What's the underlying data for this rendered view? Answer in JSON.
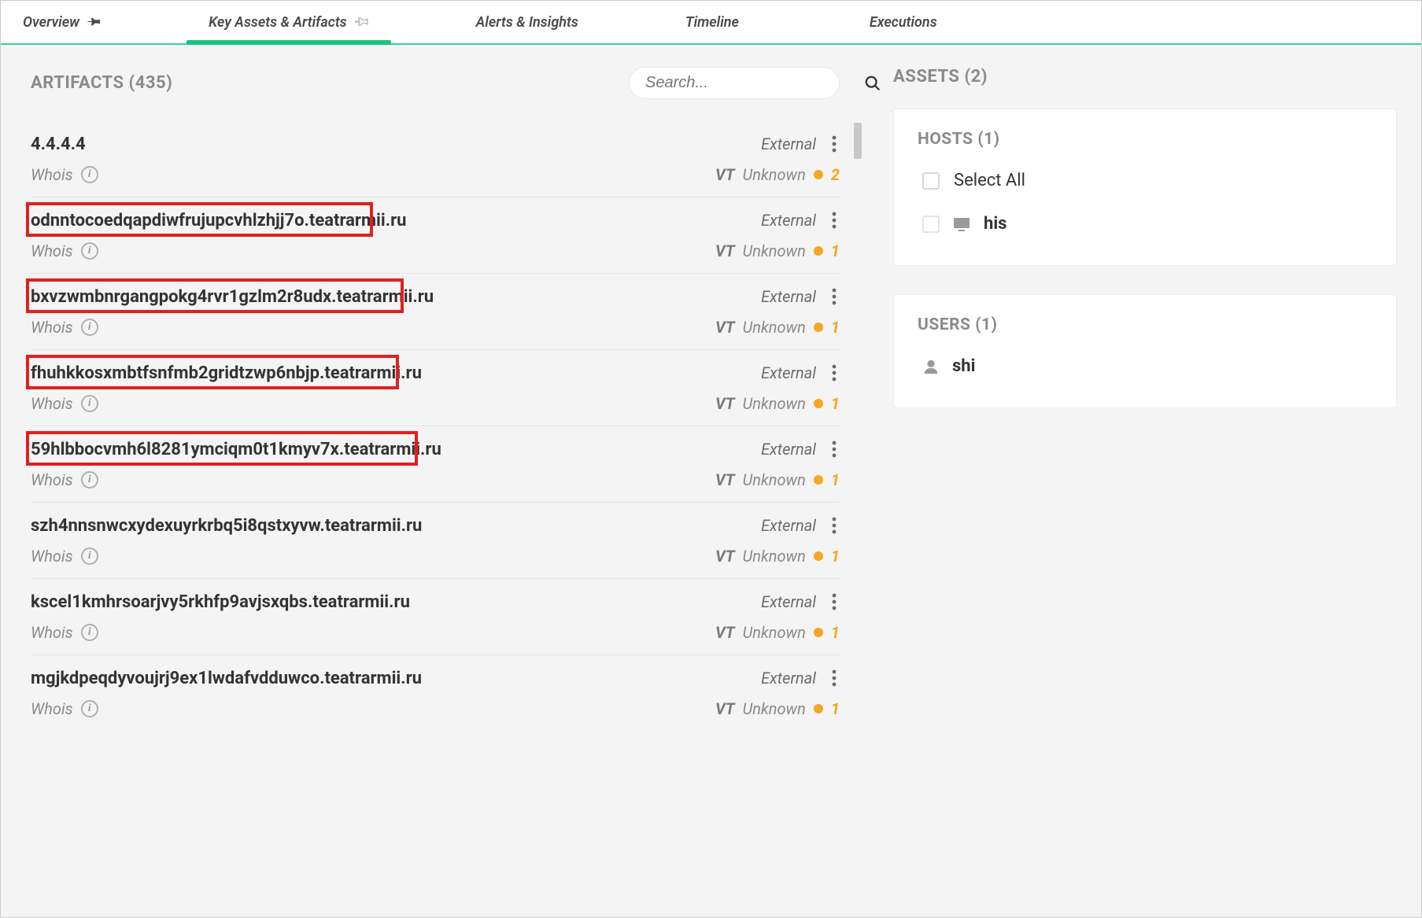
{
  "tabs": {
    "overview": "Overview",
    "key_assets": "Key Assets & Artifacts",
    "alerts": "Alerts & Insights",
    "timeline": "Timeline",
    "executions": "Executions"
  },
  "artifacts": {
    "header_label": "ARTIFACTS",
    "count": "(435)",
    "search_placeholder": "Search...",
    "whois_label": "Whois",
    "vt_prefix": "VT",
    "tag_external": "External",
    "items": [
      {
        "name": "4.4.4.4",
        "status": "Unknown",
        "count": "2",
        "highlight": false
      },
      {
        "name": "odnntocoedqapdiwfrujupcvhlzhjj7o.teatrarmii.ru",
        "status": "Unknown",
        "count": "1",
        "highlight": true,
        "highlight_width": 441
      },
      {
        "name": "bxvzwmbnrgangpokg4rvr1gzlm2r8udx.teatrarmii.ru",
        "status": "Unknown",
        "count": "1",
        "highlight": true,
        "highlight_width": 480
      },
      {
        "name": "fhuhkkosxmbtfsnfmb2gridtzwp6nbjp.teatrarmii.ru",
        "status": "Unknown",
        "count": "1",
        "highlight": true,
        "highlight_width": 474
      },
      {
        "name": "59hlbbocvmh6l8281ymciqm0t1kmyv7x.teatrarmii.ru",
        "status": "Unknown",
        "count": "1",
        "highlight": true,
        "highlight_width": 498
      },
      {
        "name": "szh4nnsnwcxydexuyrkrbq5i8qstxyvw.teatrarmii.ru",
        "status": "Unknown",
        "count": "1",
        "highlight": false
      },
      {
        "name": "kscel1kmhrsoarjvy5rkhfp9avjsxqbs.teatrarmii.ru",
        "status": "Unknown",
        "count": "1",
        "highlight": false
      },
      {
        "name": "mgjkdpeqdyvoujrj9ex1lwdafvdduwco.teatrarmii.ru",
        "status": "Unknown",
        "count": "1",
        "highlight": false
      }
    ]
  },
  "assets": {
    "header_label": "ASSETS",
    "count": "(2)",
    "hosts": {
      "title": "HOSTS (1)",
      "select_all": "Select All",
      "item_prefix": "his"
    },
    "users": {
      "title": "USERS (1)",
      "item_prefix": "shi"
    }
  }
}
